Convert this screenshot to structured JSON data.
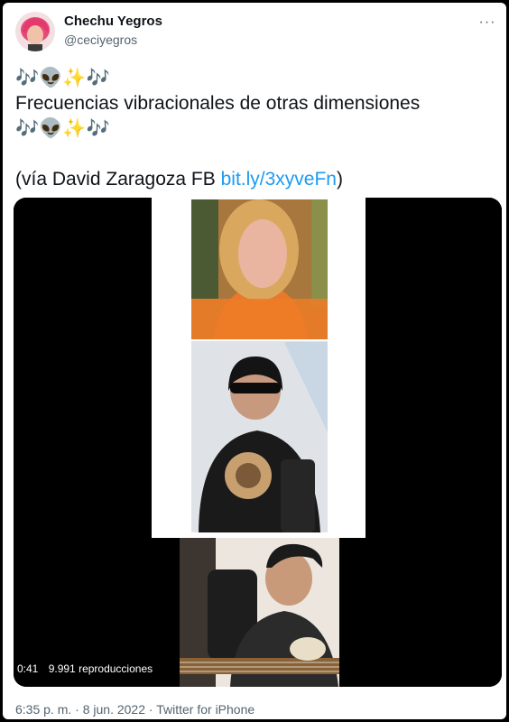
{
  "tweet": {
    "author_name": "Chechu Yegros",
    "author_handle": "@ceciyegros",
    "text_line1": "🎶👽✨🎶",
    "text_line2": "Frecuencias vibracionales de otras dimensiones",
    "text_line3": "🎶👽✨🎶",
    "text_prefix": "(vía David Zaragoza FB ",
    "link_text": "bit.ly/3xyveFn",
    "text_suffix": ")",
    "more_label": "···"
  },
  "video": {
    "duration": "0:41",
    "views": "9.991 reproducciones"
  },
  "meta": {
    "time": "6:35 p. m.",
    "separator1": " · ",
    "date": "8 jun. 2022",
    "separator2": " · ",
    "source": "Twitter for iPhone"
  },
  "colors": {
    "link": "#1d9bf0",
    "text": "#0f1419",
    "muted": "#536471"
  }
}
